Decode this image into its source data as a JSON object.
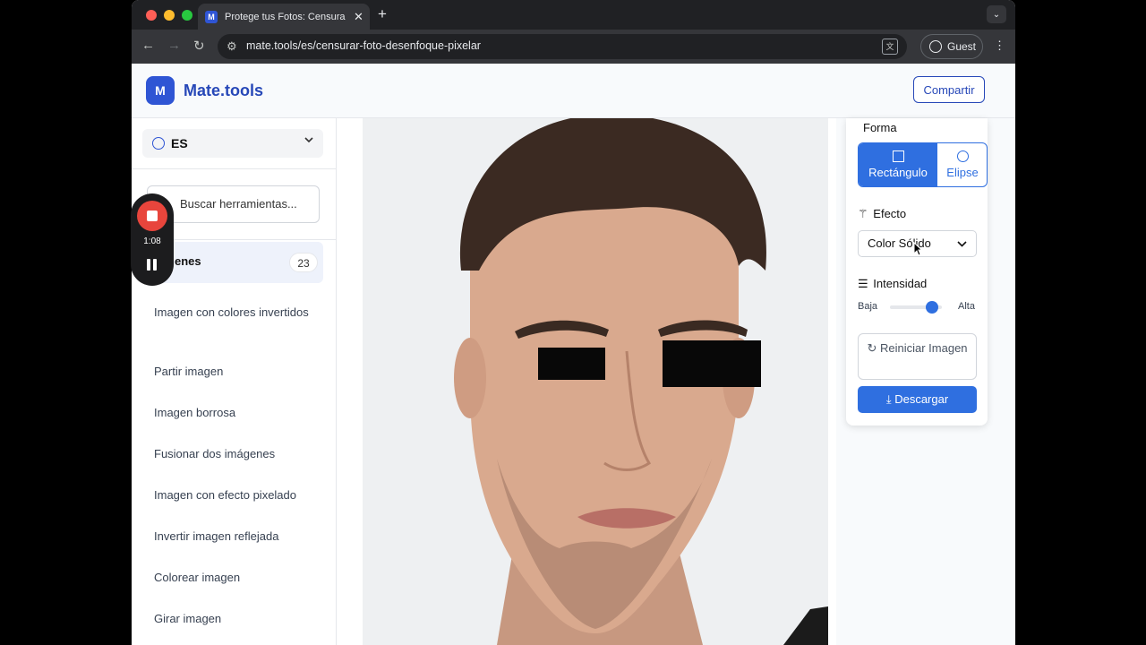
{
  "browser": {
    "tab_title": "Protege tus Fotos: Censura y",
    "tab_favicon": "M",
    "url": "mate.tools/es/censurar-foto-desenfoque-pixelar",
    "guest_label": "Guest"
  },
  "header": {
    "logo_letter": "M",
    "brand": "Mate.tools",
    "share_label": "Compartir"
  },
  "sidebar": {
    "language": "ES",
    "search_placeholder": "Buscar herramientas...",
    "category": {
      "label": "enes",
      "count": "23"
    },
    "items": [
      "Imagen con colores invertidos",
      "Partir imagen",
      "Imagen borrosa",
      "Fusionar dos imágenes",
      "Imagen con efecto pixelado",
      "Invertir imagen reflejada",
      "Colorear imagen",
      "Girar imagen"
    ]
  },
  "panel": {
    "shape_label": "Forma",
    "shape_options": [
      "Rectángulo",
      "Elipse"
    ],
    "shape_selected": "Rectángulo",
    "effect_label": "Efecto",
    "effect_value": "Color Sólido",
    "intensity_label": "Intensidad",
    "intensity_low": "Baja",
    "intensity_high": "Alta",
    "intensity_level": 0.9,
    "reset_label": "Reiniciar Imagen",
    "download_label": "Descargar"
  },
  "recorder": {
    "time": "1:08"
  },
  "colors": {
    "accent": "#2f6fe0",
    "brand": "#2748b8",
    "record_red": "#e8453c"
  }
}
